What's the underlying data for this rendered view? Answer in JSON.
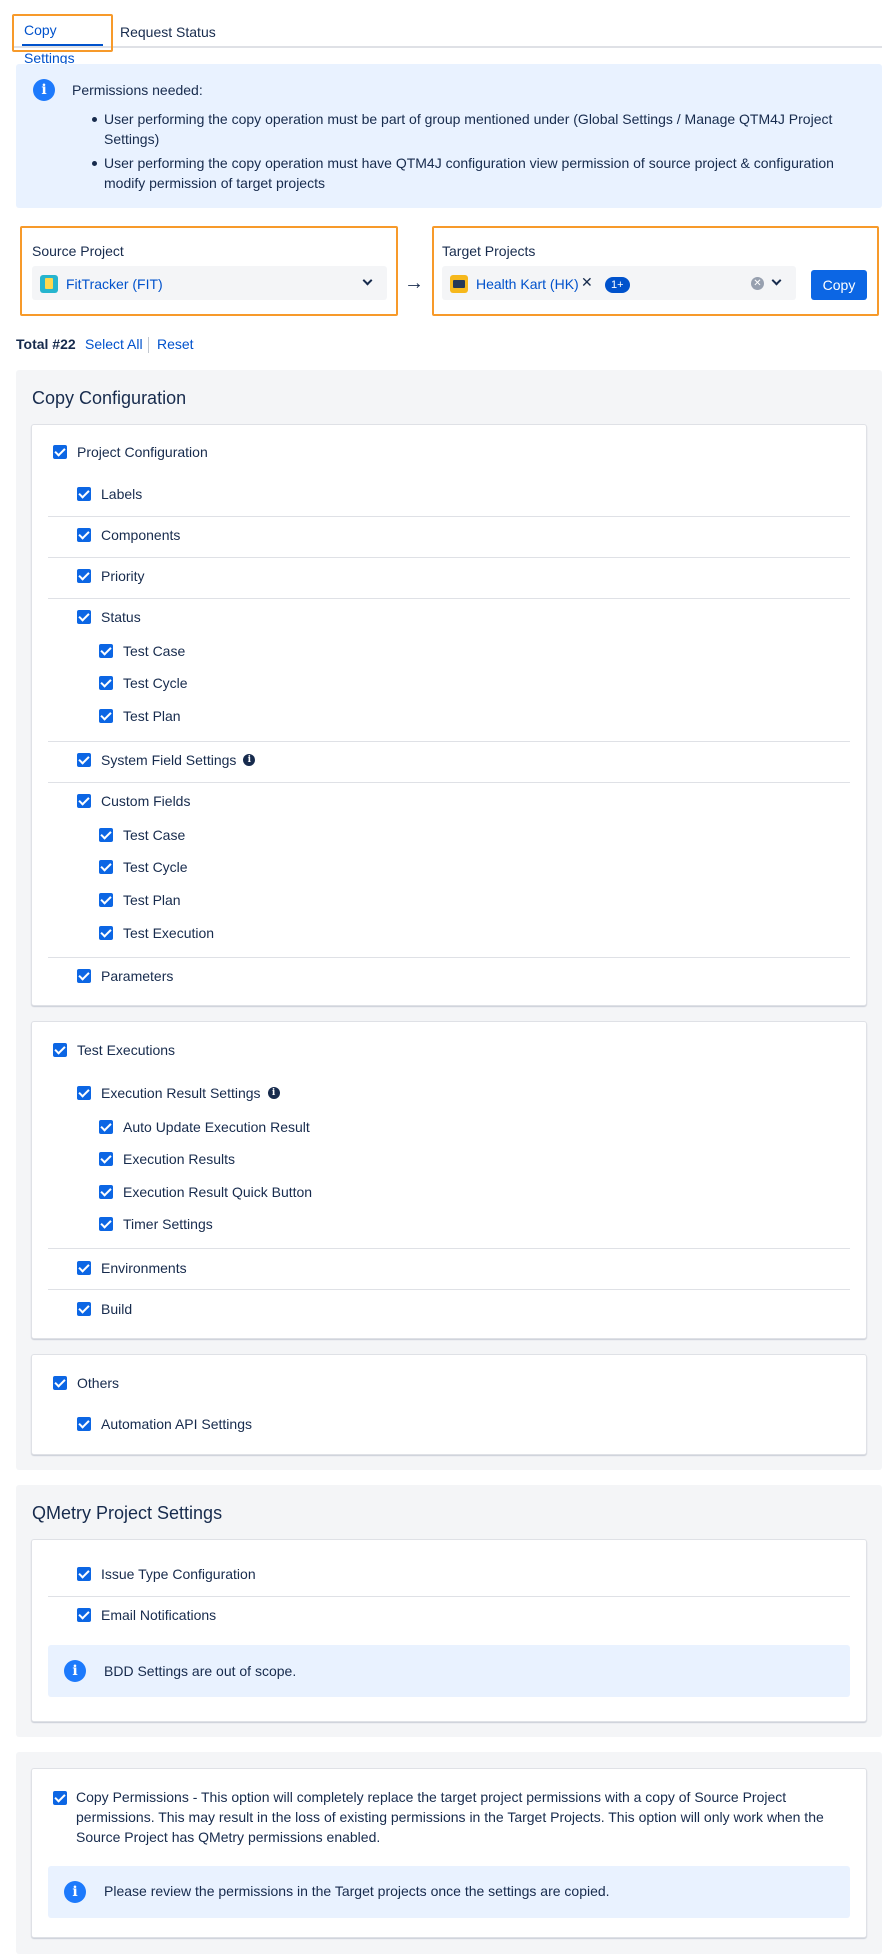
{
  "tabs": [
    {
      "label": "Copy Settings",
      "active": true
    },
    {
      "label": "Request Status",
      "active": false
    }
  ],
  "permissions": {
    "title": "Permissions needed:",
    "bullets": [
      "User performing the copy operation must be part of group mentioned under (Global Settings / Manage QTM4J Project Settings)",
      "User performing the copy operation must have QTM4J configuration view permission of source project & configuration modify permission of target projects"
    ]
  },
  "source": {
    "label": "Source Project",
    "value": "FitTracker (FIT)"
  },
  "target": {
    "label": "Target Projects",
    "value": "Health Kart (HK)",
    "more": "1+"
  },
  "copy_button": "Copy",
  "totals": {
    "total": "Total #22",
    "select_all": "Select All",
    "reset": "Reset"
  },
  "copy_configuration": {
    "title": "Copy Configuration",
    "project": {
      "label": "Project Configuration",
      "labels": "Labels",
      "components": "Components",
      "priority": "Priority",
      "status": "Status",
      "status_children": [
        "Test Case",
        "Test Cycle",
        "Test Plan"
      ],
      "system_field": "System Field Settings",
      "custom_fields": "Custom Fields",
      "custom_children": [
        "Test Case",
        "Test Cycle",
        "Test Plan",
        "Test Execution"
      ],
      "parameters": "Parameters"
    },
    "executions": {
      "label": "Test Executions",
      "result_settings": "Execution Result Settings",
      "result_children": [
        "Auto Update Execution Result",
        "Execution Results",
        "Execution Result Quick Button",
        "Timer Settings"
      ],
      "environments": "Environments",
      "build": "Build"
    },
    "others": {
      "label": "Others",
      "automation": "Automation API Settings"
    }
  },
  "qmetry": {
    "title": "QMetry Project Settings",
    "issue_type": "Issue Type Configuration",
    "email": "Email Notifications",
    "note": "BDD Settings are out of scope."
  },
  "copy_permissions": {
    "text": "Copy Permissions - This option will completely replace the target project permissions with a copy of Source Project permissions. This may result in the loss of existing permissions in the Target Projects. This option will only work when the Source Project has QMetry permissions enabled.",
    "note": "Please review the permissions in the Target projects once the settings are copied."
  }
}
